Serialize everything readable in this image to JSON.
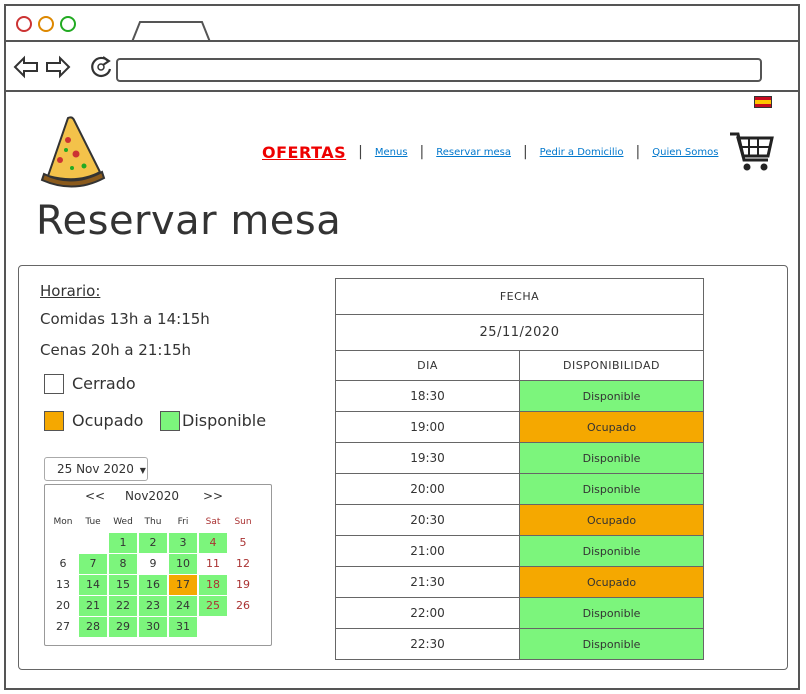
{
  "browser": {
    "dots": [
      {
        "color": "#cc3333"
      },
      {
        "color": "#dd8800"
      },
      {
        "color": "#22aa22"
      }
    ]
  },
  "nav": {
    "offers": "OFERTAS",
    "links": [
      "Menus",
      "Reservar mesa",
      "Pedir a Domicilio",
      "Quien Somos"
    ]
  },
  "page_title": "Reservar mesa",
  "hours": {
    "title": "Horario:",
    "lunch": "Comidas 13h a 14:15h",
    "dinner": "Cenas 20h a 21:15h"
  },
  "legend": {
    "closed": "Cerrado",
    "busy": "Ocupado",
    "available": "Disponible",
    "busy_color": "#f5a800",
    "available_color": "#7cf57c"
  },
  "date_select": {
    "value": "25 Nov 2020"
  },
  "calendar": {
    "prev": "<<",
    "month": "Nov2020",
    "next": ">>",
    "days_of_week": [
      "Mon",
      "Tue",
      "Wed",
      "Thu",
      "Fri",
      "Sat",
      "Sun"
    ],
    "weeks": [
      [
        "",
        "",
        "1",
        "2",
        "3",
        "4",
        "5"
      ],
      [
        "6",
        "7",
        "8",
        "9",
        "10",
        "11",
        "12"
      ],
      [
        "13",
        "14",
        "15",
        "16",
        "17",
        "18",
        "19"
      ],
      [
        "20",
        "21",
        "22",
        "23",
        "24",
        "25",
        "26"
      ],
      [
        "27",
        "28",
        "29",
        "30",
        "31",
        "",
        ""
      ]
    ],
    "available_days": [
      "1",
      "2",
      "3",
      "4",
      "7",
      "8",
      "10",
      "14",
      "15",
      "16",
      "18",
      "21",
      "22",
      "23",
      "24",
      "25",
      "28",
      "29",
      "30",
      "31"
    ],
    "busy_days": [
      "17"
    ]
  },
  "schedule": {
    "header_fecha": "FECHA",
    "date": "25/11/2020",
    "col_day": "DIA",
    "col_availability": "DISPONIBILIDAD",
    "rows": [
      {
        "time": "18:30",
        "status": "Disponible",
        "busy": false
      },
      {
        "time": "19:00",
        "status": "Ocupado",
        "busy": true
      },
      {
        "time": "19:30",
        "status": "Disponible",
        "busy": false
      },
      {
        "time": "20:00",
        "status": "Disponible",
        "busy": false
      },
      {
        "time": "20:30",
        "status": "Ocupado",
        "busy": true
      },
      {
        "time": "21:00",
        "status": "Disponible",
        "busy": false
      },
      {
        "time": "21:30",
        "status": "Ocupado",
        "busy": true
      },
      {
        "time": "22:00",
        "status": "Disponible",
        "busy": false
      },
      {
        "time": "22:30",
        "status": "Disponible",
        "busy": false
      }
    ]
  },
  "icons": {
    "flag": "spain-flag-icon",
    "logo": "pizza-slice-icon",
    "cart": "shopping-cart-icon"
  }
}
